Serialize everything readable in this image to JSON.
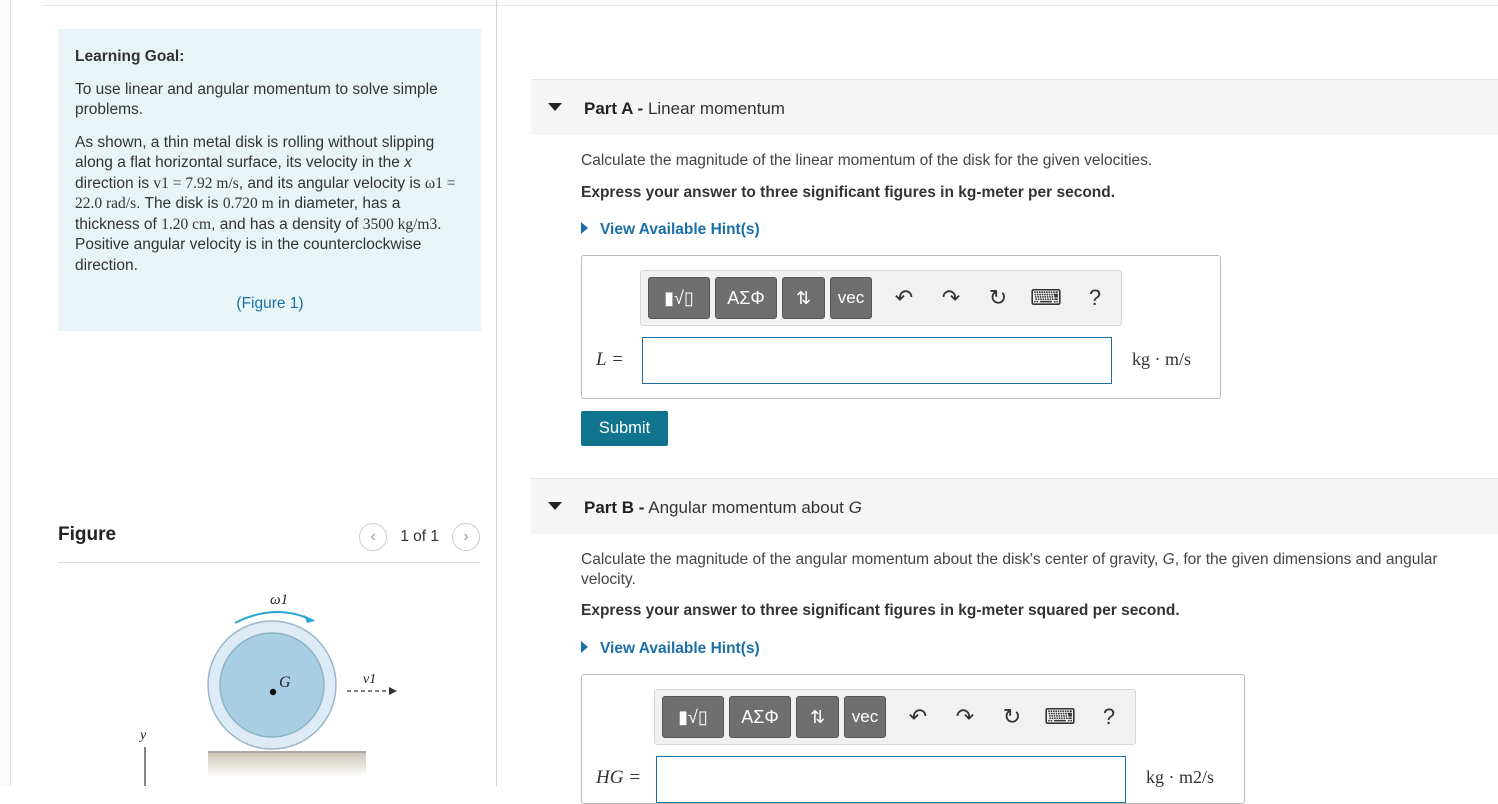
{
  "learning_goal": {
    "heading": "Learning Goal:",
    "intro": "To use linear and angular momentum to solve simple problems.",
    "body": {
      "t1": "As shown, a thin metal disk is rolling without slipping along a flat horizontal surface, its velocity in the ",
      "xvar": "x",
      "t2": " direction is ",
      "v1": "v1 = 7.92 m/s",
      "t3": ", and its angular velocity is ",
      "w1": "ω1 = 22.0 rad/s",
      "t4": ". The disk is ",
      "diam": "0.720 m",
      "t5": " in diameter, has a thickness of ",
      "thick": "1.20 cm",
      "t6": ", and has a density of ",
      "dens": "3500 kg/m3",
      "t7": ". Positive angular velocity is in the counterclockwise direction."
    },
    "figure_link": "(Figure 1)"
  },
  "figure_panel": {
    "title": "Figure",
    "pager": "1 of 1",
    "labels": {
      "omega": "ω1",
      "center": "G",
      "velocity": "v1",
      "axis_y": "y"
    }
  },
  "part_a": {
    "label": "Part A -",
    "title": "Linear momentum",
    "prompt": "Calculate the magnitude of the linear momentum of the disk for the given velocities.",
    "instruction": "Express your answer to three significant figures in kg-meter per second.",
    "hint": "View Available Hint(s)",
    "var_label": "L =",
    "unit": "kg · m/s",
    "submit": "Submit"
  },
  "part_b": {
    "label": "Part B -",
    "title_text": "Angular momentum about ",
    "title_var": "G",
    "prompt_t1": "Calculate the magnitude of the angular momentum about the disk's center of gravity, ",
    "prompt_var": "G",
    "prompt_t2": ", for the given dimensions and angular velocity.",
    "instruction": "Express your answer to three significant figures in kg-meter squared per second.",
    "hint": "View Available Hint(s)",
    "var_label": "HG =",
    "unit": "kg · m2/s"
  },
  "toolbar": {
    "template": "▮√▯",
    "greek": "ΑΣΦ",
    "arrows": "⇅",
    "vec": "vec",
    "undo": "↶",
    "redo": "↷",
    "reset": "↻",
    "keyboard": "⌨",
    "help": "?"
  },
  "colors": {
    "accent": "#1b6fa8",
    "submit": "#10748f",
    "goal_bg": "#e8f5f6",
    "disk": "#a9cde3"
  }
}
